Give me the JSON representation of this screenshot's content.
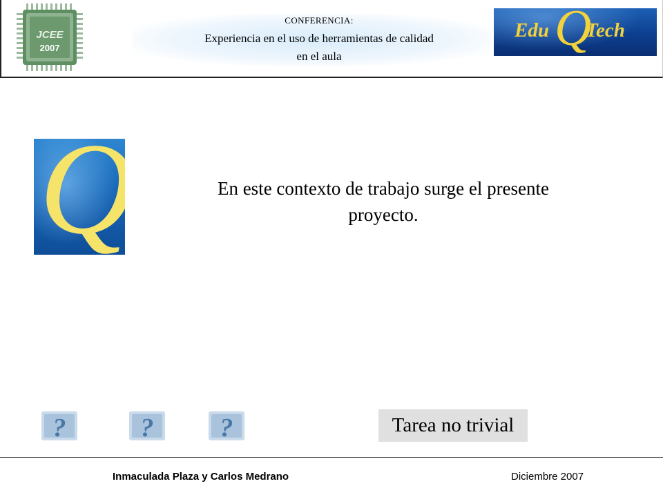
{
  "header": {
    "logo_left": {
      "text": "JCEE",
      "year": "2007",
      "icon": "chip-logo-icon"
    },
    "conference_label": "CONFERENCIA:",
    "conference_title_line1": "Experiencia en el uso de herramientas de calidad",
    "conference_title_line2": "en el aula",
    "logo_right": {
      "edu": "Edu",
      "q": "Q",
      "tech": "Tech",
      "icon": "eduqtech-logo"
    }
  },
  "slide": {
    "logo_icon": "q-logo",
    "logo_letter": "Q",
    "main_line1": "En este contexto de trabajo surge el presente",
    "main_line2": "proyecto.",
    "question_icons": [
      "question-mark-icon",
      "question-mark-icon",
      "question-mark-icon"
    ],
    "tag_label": "Tarea no trivial"
  },
  "footer": {
    "authors": "Inmaculada Plaza y Carlos Medrano",
    "date": "Diciembre  2007"
  },
  "colors": {
    "accent_yellow": "#f3d23b",
    "logo_blue": "#1867b8",
    "chip_green": "#6c9a6e",
    "tag_gray": "#e0e0e0"
  }
}
